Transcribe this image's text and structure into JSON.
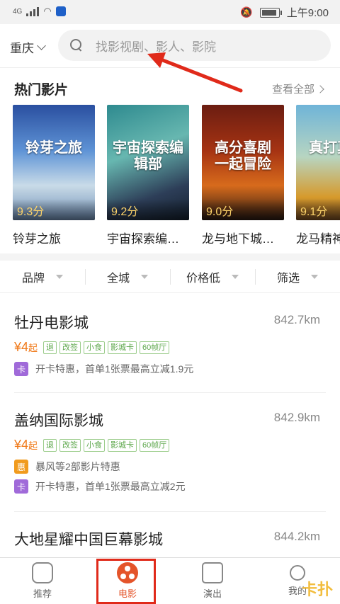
{
  "status_bar": {
    "network": "4G",
    "time": "上午9:00"
  },
  "header": {
    "city": "重庆",
    "search_placeholder": "找影视剧、影人、影院"
  },
  "hot_movies": {
    "title": "热门影片",
    "view_all": "查看全部",
    "items": [
      {
        "name": "铃芽之旅",
        "score": "9.3分",
        "poster_text": "铃芽之旅"
      },
      {
        "name": "宇宙探索编…",
        "score": "9.2分",
        "poster_text": "宇宙探索编辑部"
      },
      {
        "name": "龙与地下城…",
        "score": "9.0分",
        "poster_text": "高分喜剧 一起冒险"
      },
      {
        "name": "龙马精神",
        "score": "9.1分",
        "poster_text": "真打真心"
      }
    ]
  },
  "filters": [
    "品牌",
    "全城",
    "价格低",
    "筛选"
  ],
  "cinemas": [
    {
      "name": "牡丹电影城",
      "distance": "842.7km",
      "price": "¥4",
      "price_suffix": "起",
      "tags": [
        "退",
        "改签",
        "小食",
        "影城卡",
        "60帧厅"
      ],
      "promos": [
        {
          "badge": "卡",
          "text": "开卡特惠，首单1张票最高立减1.9元",
          "color": "#a06ad9"
        }
      ]
    },
    {
      "name": "盖纳国际影城",
      "distance": "842.9km",
      "price": "¥4",
      "price_suffix": "起",
      "tags": [
        "退",
        "改签",
        "小食",
        "影城卡",
        "60帧厅"
      ],
      "promos": [
        {
          "badge": "惠",
          "text": "暴风等2部影片特惠",
          "color": "#f19b1d"
        },
        {
          "badge": "卡",
          "text": "开卡特惠，首单1张票最高立减2元",
          "color": "#a06ad9"
        }
      ]
    },
    {
      "name": "大地星耀中国巨幕影城",
      "distance": "844.2km"
    }
  ],
  "tabbar": {
    "items": [
      {
        "label": "推荐",
        "icon": "robot-icon"
      },
      {
        "label": "电影",
        "icon": "film-reel-icon",
        "active": true
      },
      {
        "label": "演出",
        "icon": "ticket-star-icon"
      },
      {
        "label": "我的",
        "icon": "user-icon"
      }
    ]
  },
  "watermark": "卡扑",
  "colors": {
    "accent": "#e4542a",
    "price": "#f07a1a",
    "tag_green": "#5da74b",
    "annotation_red": "#e02a1a"
  }
}
